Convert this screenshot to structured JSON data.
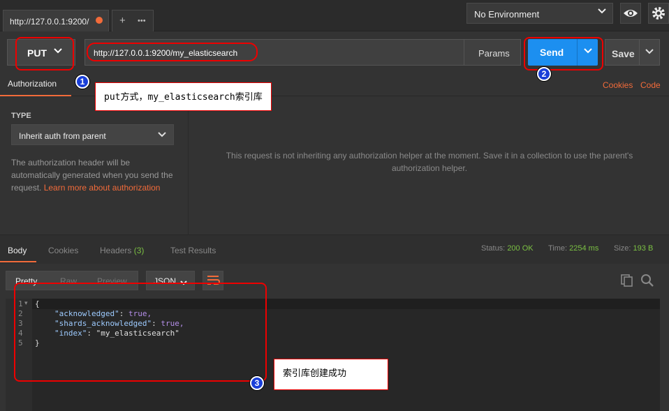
{
  "tab": {
    "title": "http://127.0.0.1:9200/",
    "add_label": "+",
    "more_label": "•••"
  },
  "environment": {
    "selected": "No Environment"
  },
  "request": {
    "method": "PUT",
    "url": "http://127.0.0.1:9200/my_elasticsearch",
    "params_label": "Params",
    "send_label": "Send",
    "save_label": "Save"
  },
  "subtabs": {
    "authorization": "Authorization",
    "cookies": "Cookies",
    "code": "Code"
  },
  "auth": {
    "type_label": "TYPE",
    "type_value": "Inherit auth from parent",
    "desc": "The authorization header will be automatically generated when you send the request.",
    "link": "Learn more about authorization",
    "help": "This request is not inheriting any authorization helper at the moment. Save it in a collection to use the parent's authorization helper."
  },
  "response": {
    "tabs": {
      "body": "Body",
      "cookies": "Cookies",
      "headers": "Headers",
      "headers_count": "(3)",
      "test_results": "Test Results"
    },
    "status_label": "Status:",
    "status_value": "200 OK",
    "time_label": "Time:",
    "time_value": "2254 ms",
    "size_label": "Size:",
    "size_value": "193 B",
    "formats": {
      "pretty": "Pretty",
      "raw": "Raw",
      "preview": "Preview",
      "type": "JSON"
    },
    "body_lines": [
      {
        "num": "1",
        "text": "{"
      },
      {
        "num": "2",
        "key": "\"acknowledged\"",
        "value": "true,"
      },
      {
        "num": "3",
        "key": "\"shards_acknowledged\"",
        "value": "true,"
      },
      {
        "num": "4",
        "key": "\"index\"",
        "value": "\"my_elasticsearch\""
      },
      {
        "num": "5",
        "text": "}"
      }
    ]
  },
  "annotations": {
    "callout1": "put方式，my_elasticsearch索引库",
    "callout3": "索引库创建成功",
    "marker1": "1",
    "marker2": "2",
    "marker3": "3"
  },
  "colors": {
    "accent": "#f26b3a",
    "send": "#1c8ff0",
    "success": "#7bc043",
    "annotation": "#e00000",
    "marker": "#1a3fd8"
  },
  "icons": [
    "chevron-down-icon",
    "eye-icon",
    "gear-icon",
    "wrap-lines-icon",
    "copy-icon",
    "search-icon"
  ]
}
